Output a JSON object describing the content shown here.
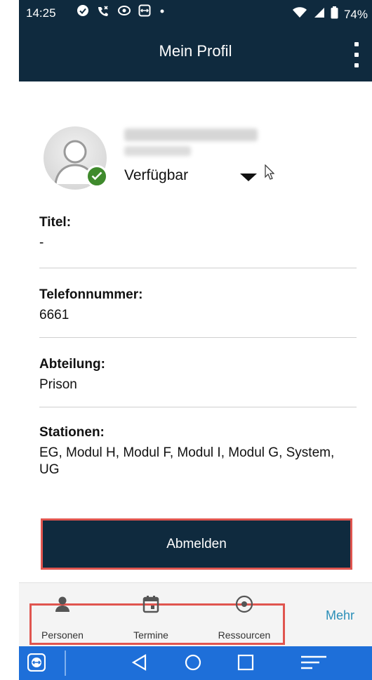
{
  "status_bar": {
    "time": "14:25",
    "battery": "74%",
    "icons": [
      "check-circle-icon",
      "missed-call-icon",
      "eye-icon",
      "app-icon",
      "dot-icon",
      "wifi-icon",
      "signal-icon",
      "battery-icon"
    ]
  },
  "app_bar": {
    "title": "Mein Profil"
  },
  "profile": {
    "status": "Verfügbar",
    "status_color": "#3f8a2c"
  },
  "fields": [
    {
      "label": "Titel:",
      "value": "-"
    },
    {
      "label": "Telefonnummer:",
      "value": "6661"
    },
    {
      "label": "Abteilung:",
      "value": "Prison"
    },
    {
      "label": "Stationen:",
      "value": "EG, Modul H, Modul F, Modul I, Modul G, System, UG"
    }
  ],
  "logout_label": "Abmelden",
  "bottom_nav": {
    "items": [
      {
        "label": "Personen",
        "icon": "person-icon"
      },
      {
        "label": "Termine",
        "icon": "calendar-icon"
      },
      {
        "label": "Ressourcen",
        "icon": "resource-target-icon"
      }
    ],
    "more_label": "Mehr",
    "more_color": "#2b8fb8"
  },
  "colors": {
    "primary": "#0f2a3e",
    "highlight": "#e0554f",
    "system_nav": "#1e6fd9"
  }
}
